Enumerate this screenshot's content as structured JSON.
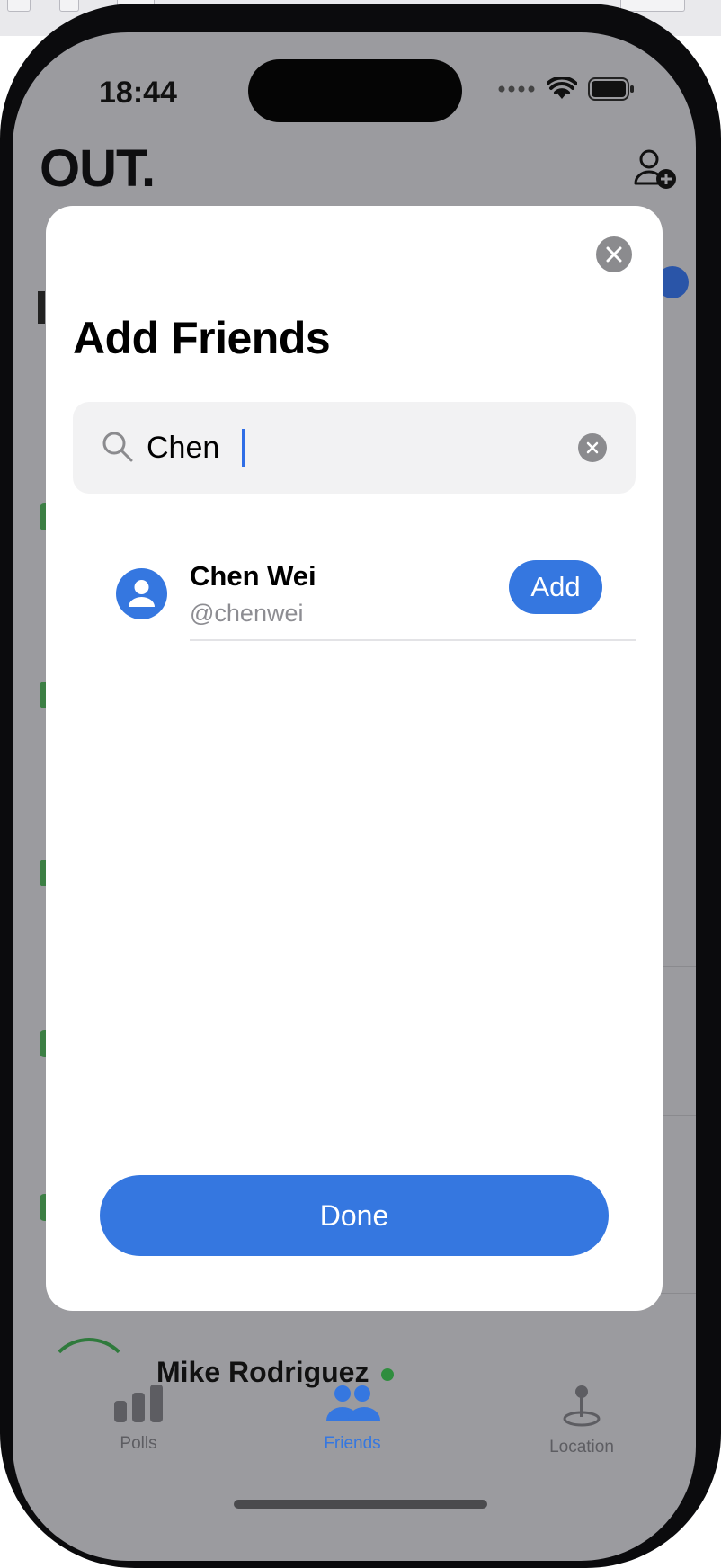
{
  "status_bar": {
    "time": "18:44"
  },
  "background_app": {
    "logo": "OUT.",
    "visible_friend": {
      "name": "Mike Rodriguez"
    }
  },
  "modal": {
    "title": "Add Friends",
    "search": {
      "value": "Chen"
    },
    "results": [
      {
        "name": "Chen Wei",
        "handle": "@chenwei",
        "action_label": "Add"
      }
    ],
    "done_label": "Done"
  },
  "tabbar": {
    "tabs": [
      {
        "label": "Polls",
        "icon": "bar-chart-icon",
        "active": false
      },
      {
        "label": "Friends",
        "icon": "people-icon",
        "active": true
      },
      {
        "label": "Location",
        "icon": "pin-icon",
        "active": false
      }
    ]
  },
  "colors": {
    "accent": "#3577e0",
    "dim_overlay": "#9b9b9f",
    "online": "#2f8d3e"
  }
}
